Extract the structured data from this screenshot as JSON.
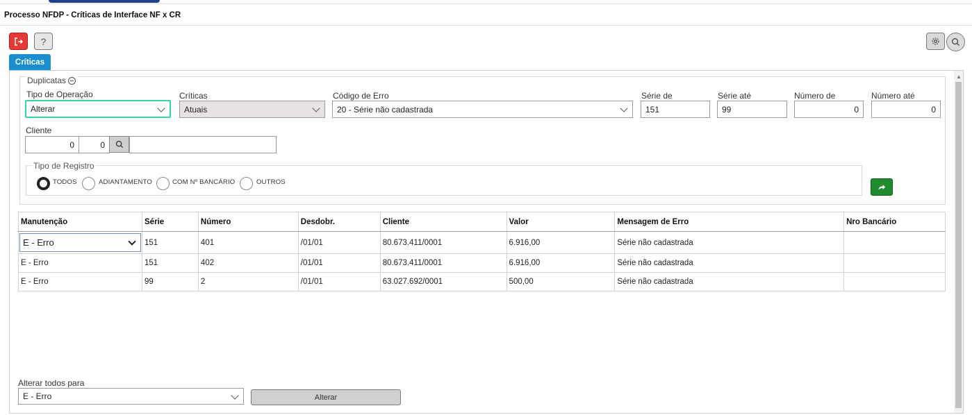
{
  "window": {
    "title": "Processo NFDP - Críticas de Interface NF x CR"
  },
  "toolbar": {
    "help_label": "?"
  },
  "tabs": [
    {
      "label": "Críticas"
    }
  ],
  "filters": {
    "section_label": "Duplicatas",
    "tipo_operacao": {
      "label": "Tipo de Operação",
      "value": "Alterar"
    },
    "criticas": {
      "label": "Críticas",
      "value": "Atuais"
    },
    "codigo_erro": {
      "label": "Código de Erro",
      "value": "20 - Série não cadastrada"
    },
    "serie_de": {
      "label": "Série de",
      "value": "151"
    },
    "serie_ate": {
      "label": "Série até",
      "value": "99"
    },
    "numero_de": {
      "label": "Número de",
      "value": "0"
    },
    "numero_ate": {
      "label": "Número até",
      "value": "0"
    },
    "cliente": {
      "label": "Cliente",
      "code1": "0",
      "code2": "0",
      "name": ""
    }
  },
  "tipo_registro": {
    "label": "Tipo de Registro",
    "options": [
      {
        "label": "TODOS",
        "selected": true
      },
      {
        "label": "ADIANTAMENTO",
        "selected": false
      },
      {
        "label": "COM Nº BANCÁRIO",
        "selected": false
      },
      {
        "label": "OUTROS",
        "selected": false
      }
    ]
  },
  "table": {
    "columns": [
      "Manutenção",
      "Série",
      "Número",
      "Desdobr.",
      "Cliente",
      "Valor",
      "Mensagem de Erro",
      "Nro Bancário"
    ],
    "rows": [
      [
        "E - Erro",
        "151",
        "401",
        "/01/01",
        "80.673.411/0001",
        "6.916,00",
        "Série não cadastrada",
        ""
      ],
      [
        "E - Erro",
        "151",
        "402",
        "/01/01",
        "80.673.411/0001",
        "6.916,00",
        "Série não cadastrada",
        ""
      ],
      [
        "E - Erro",
        "99",
        "2",
        "/01/01",
        "63.027.692/0001",
        "500,00",
        "Série não cadastrada",
        ""
      ]
    ]
  },
  "bulk": {
    "label": "Alterar todos para",
    "value": "E - Erro",
    "button_label": "Alterar"
  },
  "colors": {
    "accent": "#1a8fd0",
    "danger": "#e53935",
    "success": "#1f8a2e",
    "focus": "#36d3a6"
  }
}
